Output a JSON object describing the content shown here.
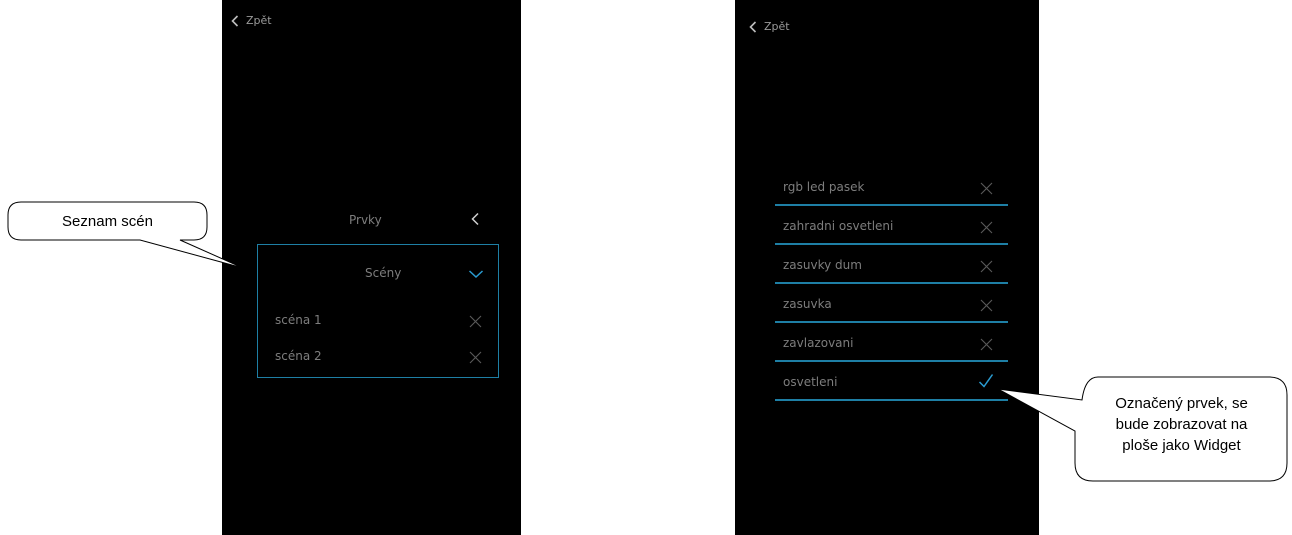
{
  "left_screen": {
    "back_label": "Zpět",
    "section_elements": "Prvky",
    "section_scenes": "Scény",
    "scenes": [
      {
        "label": "scéna 1"
      },
      {
        "label": "scéna 2"
      }
    ]
  },
  "right_screen": {
    "back_label": "Zpět",
    "items": [
      {
        "label": "rgb led pasek",
        "state": "x"
      },
      {
        "label": "zahradni osvetleni",
        "state": "x"
      },
      {
        "label": "zasuvky dum",
        "state": "x"
      },
      {
        "label": "zasuvka",
        "state": "x"
      },
      {
        "label": "zavlazovani",
        "state": "x"
      },
      {
        "label": "osvetleni",
        "state": "check"
      }
    ]
  },
  "callouts": {
    "left": "Seznam scén",
    "right_lines": [
      "Označený prvek, se",
      "bude zobrazovat na",
      "ploše jako Widget"
    ]
  },
  "colors": {
    "screen_bg": "#000000",
    "accent": "#1e7fa5",
    "check": "#2a9bd0",
    "text": "#7d7d7d"
  },
  "icons": {
    "back": "chevron-left-icon",
    "collapse": "chevron-left-icon",
    "expand": "chevron-down-icon",
    "remove": "close-icon",
    "selected": "check-icon"
  }
}
